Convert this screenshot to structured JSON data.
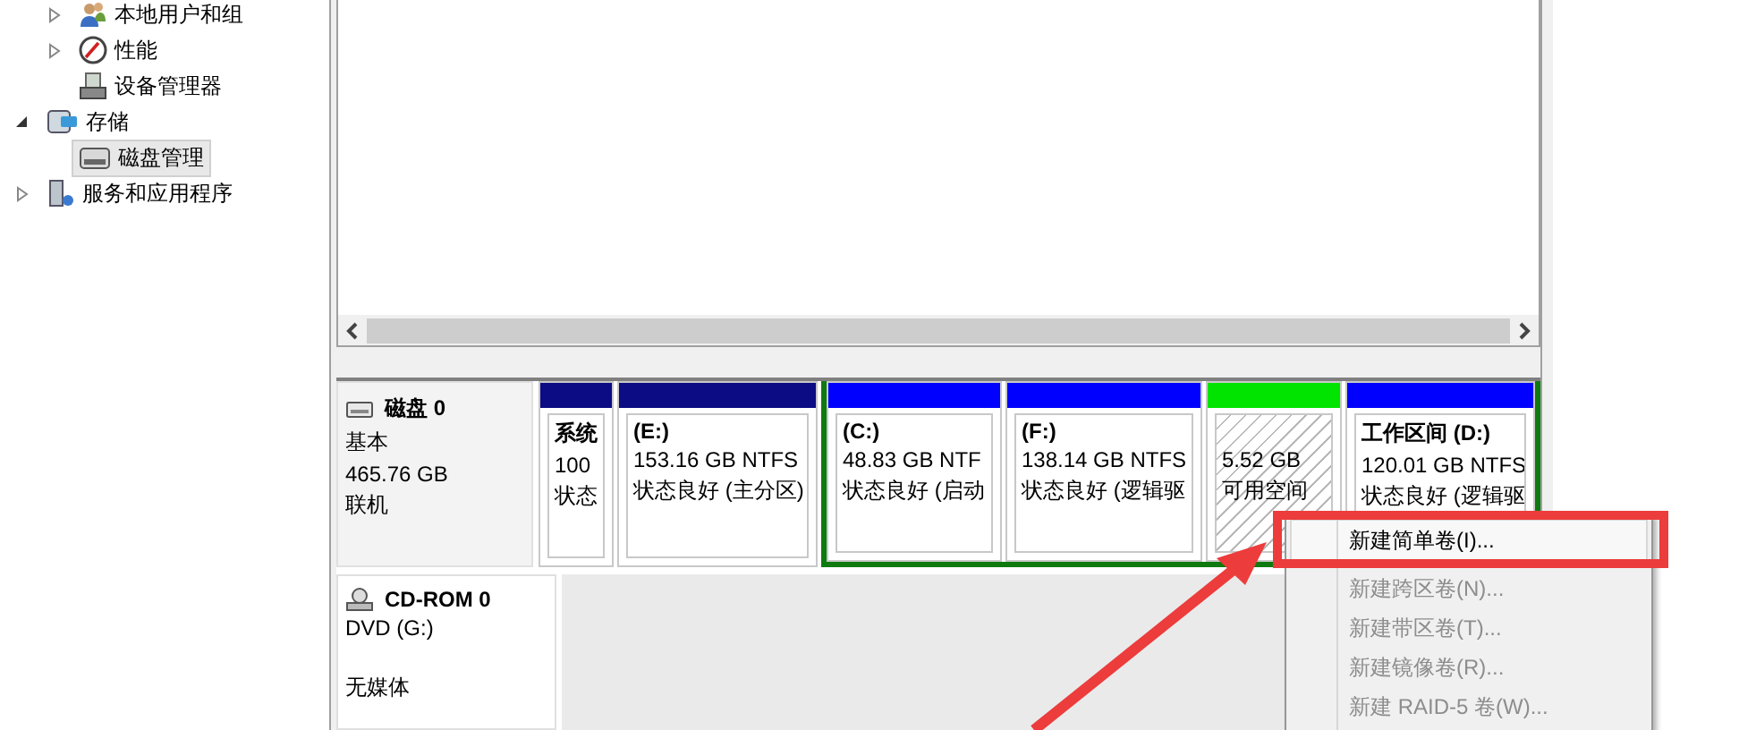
{
  "tree": {
    "cut_branch": [
      {
        "label": "本地用户和组",
        "expanded": false,
        "selected": false
      },
      {
        "label": "性能",
        "expanded": false,
        "selected": false
      },
      {
        "label": "设备管理器",
        "selected": false
      }
    ],
    "items": [
      {
        "label": "存储",
        "expanded": true,
        "selected": false,
        "children": [
          {
            "label": "磁盘管理",
            "selected": true
          }
        ]
      },
      {
        "label": "服务和应用程序",
        "expanded": false,
        "selected": false
      }
    ]
  },
  "disks": [
    {
      "kind": "disk",
      "name": "磁盘 0",
      "lines": [
        "基本",
        "465.76 GB",
        "联机"
      ],
      "partitions": [
        {
          "kind": "primary",
          "name": "系统",
          "size": "100",
          "status": "状态"
        },
        {
          "kind": "primary",
          "name": "(E:)",
          "size": "153.16 GB NTFS",
          "status": "状态良好 (主分区)"
        }
      ],
      "extended": [
        {
          "kind": "logical",
          "name": "(C:)",
          "size": "48.83 GB NTF",
          "status": "状态良好 (启动"
        },
        {
          "kind": "logical",
          "name": "(F:)",
          "size": "138.14 GB NTFS",
          "status": "状态良好 (逻辑驱"
        },
        {
          "kind": "free",
          "size": "5.52 GB",
          "status": "可用空间"
        },
        {
          "kind": "logical",
          "name": "工作区间   (D:)",
          "size": "120.01 GB NTFS",
          "status": "状态良好 (逻辑驱"
        }
      ]
    },
    {
      "kind": "cdrom",
      "name": "CD-ROM 0",
      "lines": [
        "DVD (G:)",
        "无媒体"
      ]
    }
  ],
  "context_menu": [
    {
      "label": "新建简单卷(I)...",
      "disabled": false,
      "selected": true
    },
    {
      "label": "新建跨区卷(N)...",
      "disabled": true,
      "selected": false
    },
    {
      "label": "新建带区卷(T)...",
      "disabled": true,
      "selected": false
    },
    {
      "label": "新建镜像卷(R)...",
      "disabled": true,
      "selected": false
    },
    {
      "label": "新建 RAID-5 卷(W)...",
      "disabled": true,
      "selected": false
    }
  ]
}
